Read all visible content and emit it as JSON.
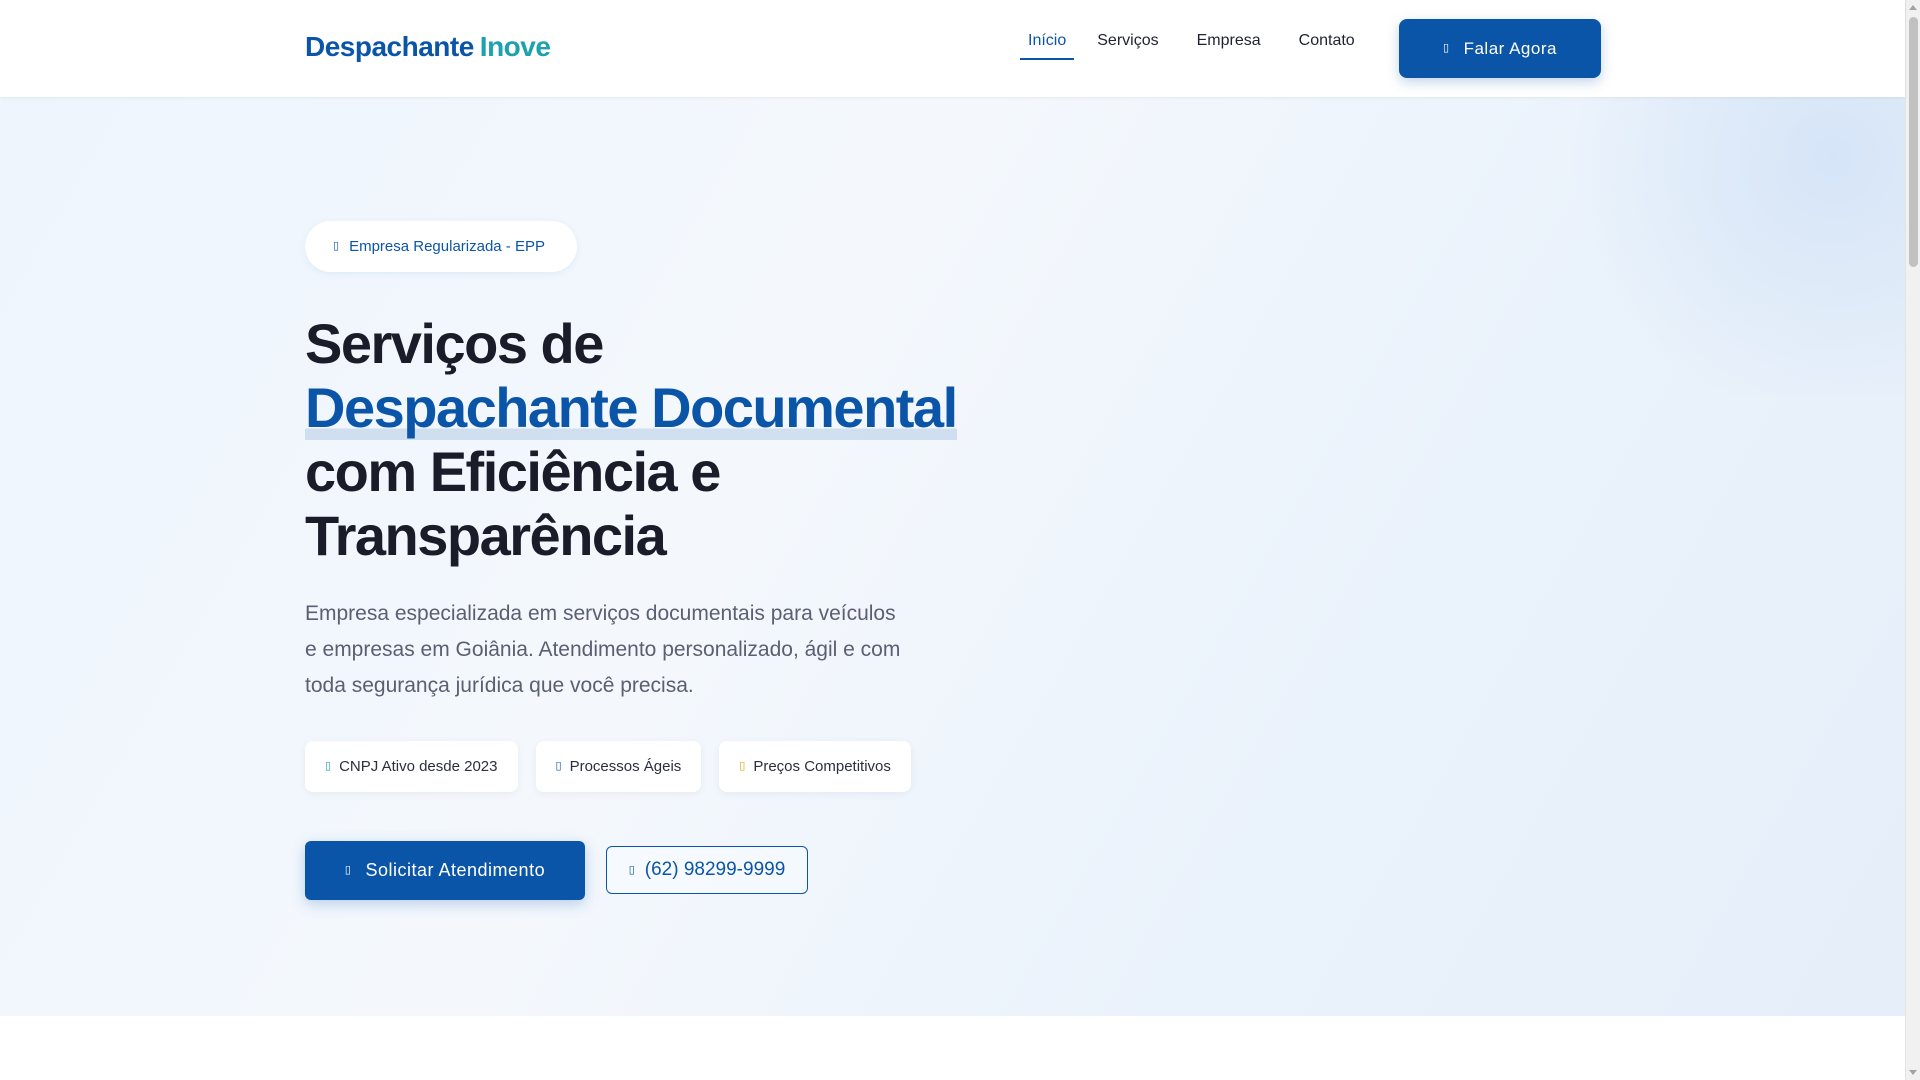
{
  "header": {
    "logo_part1": "Despachante",
    "logo_part2": "Inove",
    "nav": [
      {
        "label": "Início",
        "active": true
      },
      {
        "label": "Serviços"
      },
      {
        "label": "Empresa"
      },
      {
        "label": "Contato"
      }
    ],
    "cta_label": "Falar Agora",
    "cta_icon": "whatsapp-icon"
  },
  "hero": {
    "pill_label": "Empresa Regularizada - EPP",
    "pill_icon": "check-badge-icon",
    "title_line1": "Serviços de",
    "title_highlight": "Despachante Documental",
    "title_line3": "com Eficiência e",
    "title_line4": "Transparência",
    "description": "Empresa especializada em serviços documentais para veículos e empresas em Goiânia. Atendimento personalizado, ágil e com toda segurança jurídica que você precisa.",
    "badges": [
      {
        "label": "CNPJ Ativo desde 2023",
        "icon": "certificate-icon"
      },
      {
        "label": "Processos Ágeis",
        "icon": "bolt-icon"
      },
      {
        "label": "Preços Competitivos",
        "icon": "tag-icon"
      }
    ],
    "primary_button": "Solicitar Atendimento",
    "primary_icon": "whatsapp-icon",
    "phone_button": "(62) 98299-9999",
    "phone_icon": "phone-icon"
  },
  "colors": {
    "primary": "#0b55a8",
    "accent": "#1ea0b3",
    "text": "#1a1d29",
    "muted": "#5a6071"
  }
}
